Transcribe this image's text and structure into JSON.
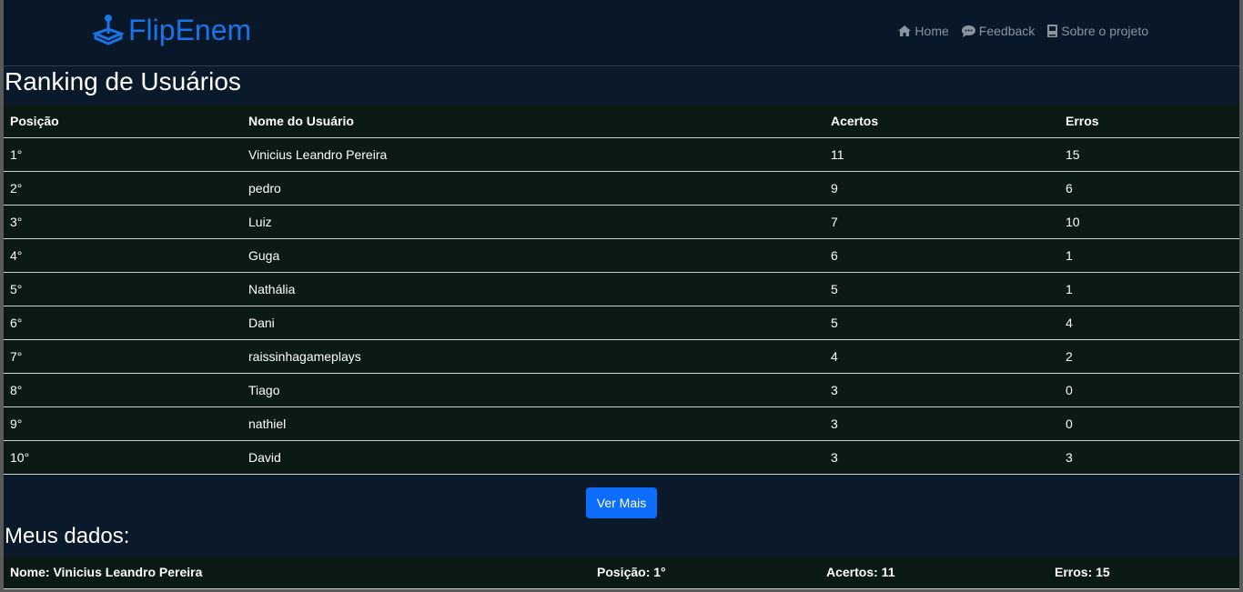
{
  "brand": {
    "name": "FlipEnem",
    "color": "#1a73e8"
  },
  "nav": [
    {
      "label": "Home",
      "icon": "home-icon"
    },
    {
      "label": "Feedback",
      "icon": "chat-icon"
    },
    {
      "label": "Sobre o projeto",
      "icon": "book-icon"
    }
  ],
  "ranking": {
    "title": "Ranking de Usuários",
    "headers": {
      "pos": "Posição",
      "name": "Nome do Usuário",
      "acertos": "Acertos",
      "erros": "Erros"
    },
    "rows": [
      {
        "pos": "1°",
        "name": "Vinicius Leandro Pereira",
        "acertos": "11",
        "erros": "15"
      },
      {
        "pos": "2°",
        "name": "pedro",
        "acertos": "9",
        "erros": "6"
      },
      {
        "pos": "3°",
        "name": "Luiz",
        "acertos": "7",
        "erros": "10"
      },
      {
        "pos": "4°",
        "name": "Guga",
        "acertos": "6",
        "erros": "1"
      },
      {
        "pos": "5°",
        "name": "Nathália",
        "acertos": "5",
        "erros": "1"
      },
      {
        "pos": "6°",
        "name": "Dani",
        "acertos": "5",
        "erros": "4"
      },
      {
        "pos": "7°",
        "name": "raissinhagameplays",
        "acertos": "4",
        "erros": "2"
      },
      {
        "pos": "8°",
        "name": "Tiago",
        "acertos": "3",
        "erros": "0"
      },
      {
        "pos": "9°",
        "name": "nathiel",
        "acertos": "3",
        "erros": "0"
      },
      {
        "pos": "10°",
        "name": "David",
        "acertos": "3",
        "erros": "3"
      }
    ],
    "more_label": "Ver Mais"
  },
  "my_data": {
    "title": "Meus dados:",
    "name": "Nome: Vinicius Leandro Pereira",
    "position": "Posição: 1°",
    "acertos": "Acertos: 11",
    "erros": "Erros: 15"
  }
}
